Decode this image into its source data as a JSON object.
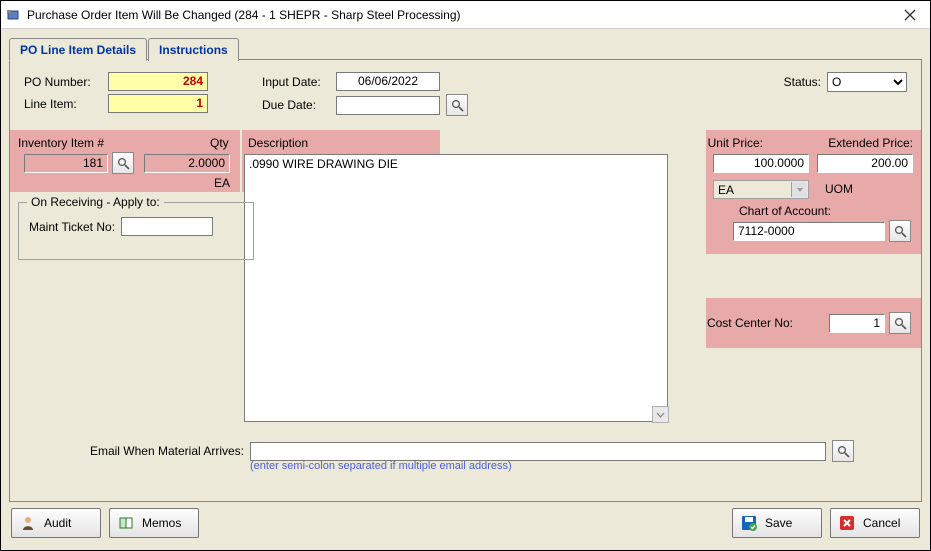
{
  "window": {
    "title": "Purchase Order Item Will Be Changed  (284 - 1  SHEPR - Sharp Steel Processing)"
  },
  "tabs": {
    "active": "PO Line Item Details",
    "items": [
      "PO Line Item Details",
      "Instructions"
    ]
  },
  "header": {
    "po_number_label": "PO Number:",
    "po_number_value": "284",
    "line_item_label": "Line Item:",
    "line_item_value": "1",
    "input_date_label": "Input Date:",
    "input_date_value": "06/06/2022",
    "due_date_label": "Due Date:",
    "due_date_value": "",
    "status_label": "Status:",
    "status_value": "O"
  },
  "inventory": {
    "item_label": "Inventory Item #",
    "item_value": "181",
    "qty_label": "Qty",
    "qty_value": "2.0000",
    "uom_small": "EA",
    "desc_label": "Description",
    "desc_value": ".0990 WIRE DRAWING DIE"
  },
  "receiving": {
    "group_label": "On Receiving - Apply to:",
    "maint_label": "Maint Ticket No:",
    "maint_value": ""
  },
  "pricing": {
    "unit_price_label": "Unit Price:",
    "unit_price_value": "100.0000",
    "ext_price_label": "Extended Price:",
    "ext_price_value": "200.00",
    "uom_combo_value": "EA",
    "uom_label": "UOM",
    "coa_label": "Chart of Account:",
    "coa_value": "7112-0000",
    "cost_center_label": "Cost Center No:",
    "cost_center_value": "1"
  },
  "email": {
    "label": "Email When Material Arrives:",
    "value": "",
    "hint": "(enter semi-colon separated if multiple email address)"
  },
  "buttons": {
    "audit": "Audit",
    "memos": "Memos",
    "save": "Save",
    "cancel": "Cancel"
  },
  "colors": {
    "highlight": "#e8a9a9"
  }
}
